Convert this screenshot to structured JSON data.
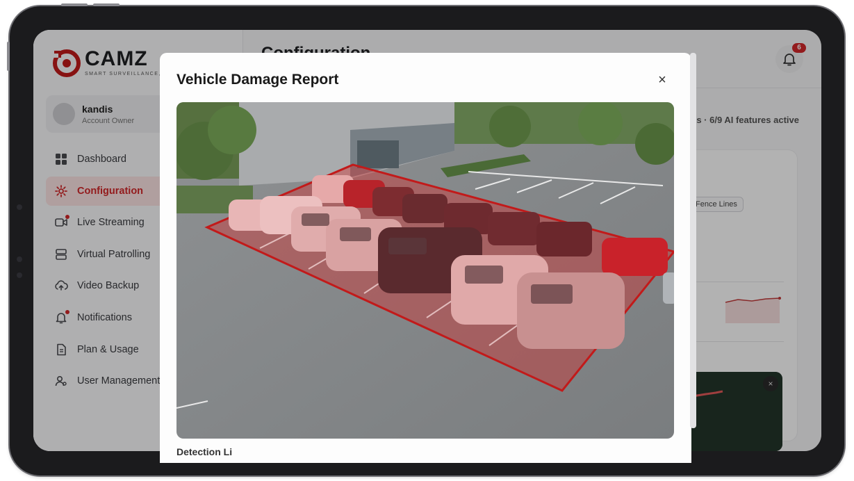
{
  "app": {
    "brand": "CAMZ",
    "tagline": "SMART SURVEILLANCE, S"
  },
  "profile": {
    "name": "kandis",
    "role": "Account Owner"
  },
  "sidebar": {
    "items": [
      {
        "label": "Dashboard",
        "icon": "grid-icon",
        "active": false,
        "dot": false
      },
      {
        "label": "Configuration",
        "icon": "gear-icon",
        "active": true,
        "dot": false
      },
      {
        "label": "Live Streaming",
        "icon": "video-camera-icon",
        "active": false,
        "dot": true
      },
      {
        "label": "Virtual Patrolling",
        "icon": "server-icon",
        "active": false,
        "dot": false
      },
      {
        "label": "Video Backup",
        "icon": "cloud-upload-icon",
        "active": false,
        "dot": false
      },
      {
        "label": "Notifications",
        "icon": "bell-icon",
        "active": false,
        "dot": true
      },
      {
        "label": "Plan & Usage",
        "icon": "document-icon",
        "active": false,
        "dot": false
      },
      {
        "label": "User Management",
        "icon": "users-icon",
        "active": false,
        "dot": false
      }
    ]
  },
  "header": {
    "title": "Configuration",
    "notification_count": "6"
  },
  "main": {
    "features_status": "s · 6/9 AI features active",
    "fence_chip": "Fence Lines"
  },
  "modal": {
    "title": "Vehicle Damage Report",
    "close_symbol": "×",
    "section_label": "Detection Li"
  },
  "mini_player": {
    "close_symbol": "×"
  },
  "colors": {
    "accent": "#d3282a",
    "active_bg": "#fde4e4",
    "zone_fill": "#dc2626",
    "zone_stroke": "#c21a1a"
  }
}
